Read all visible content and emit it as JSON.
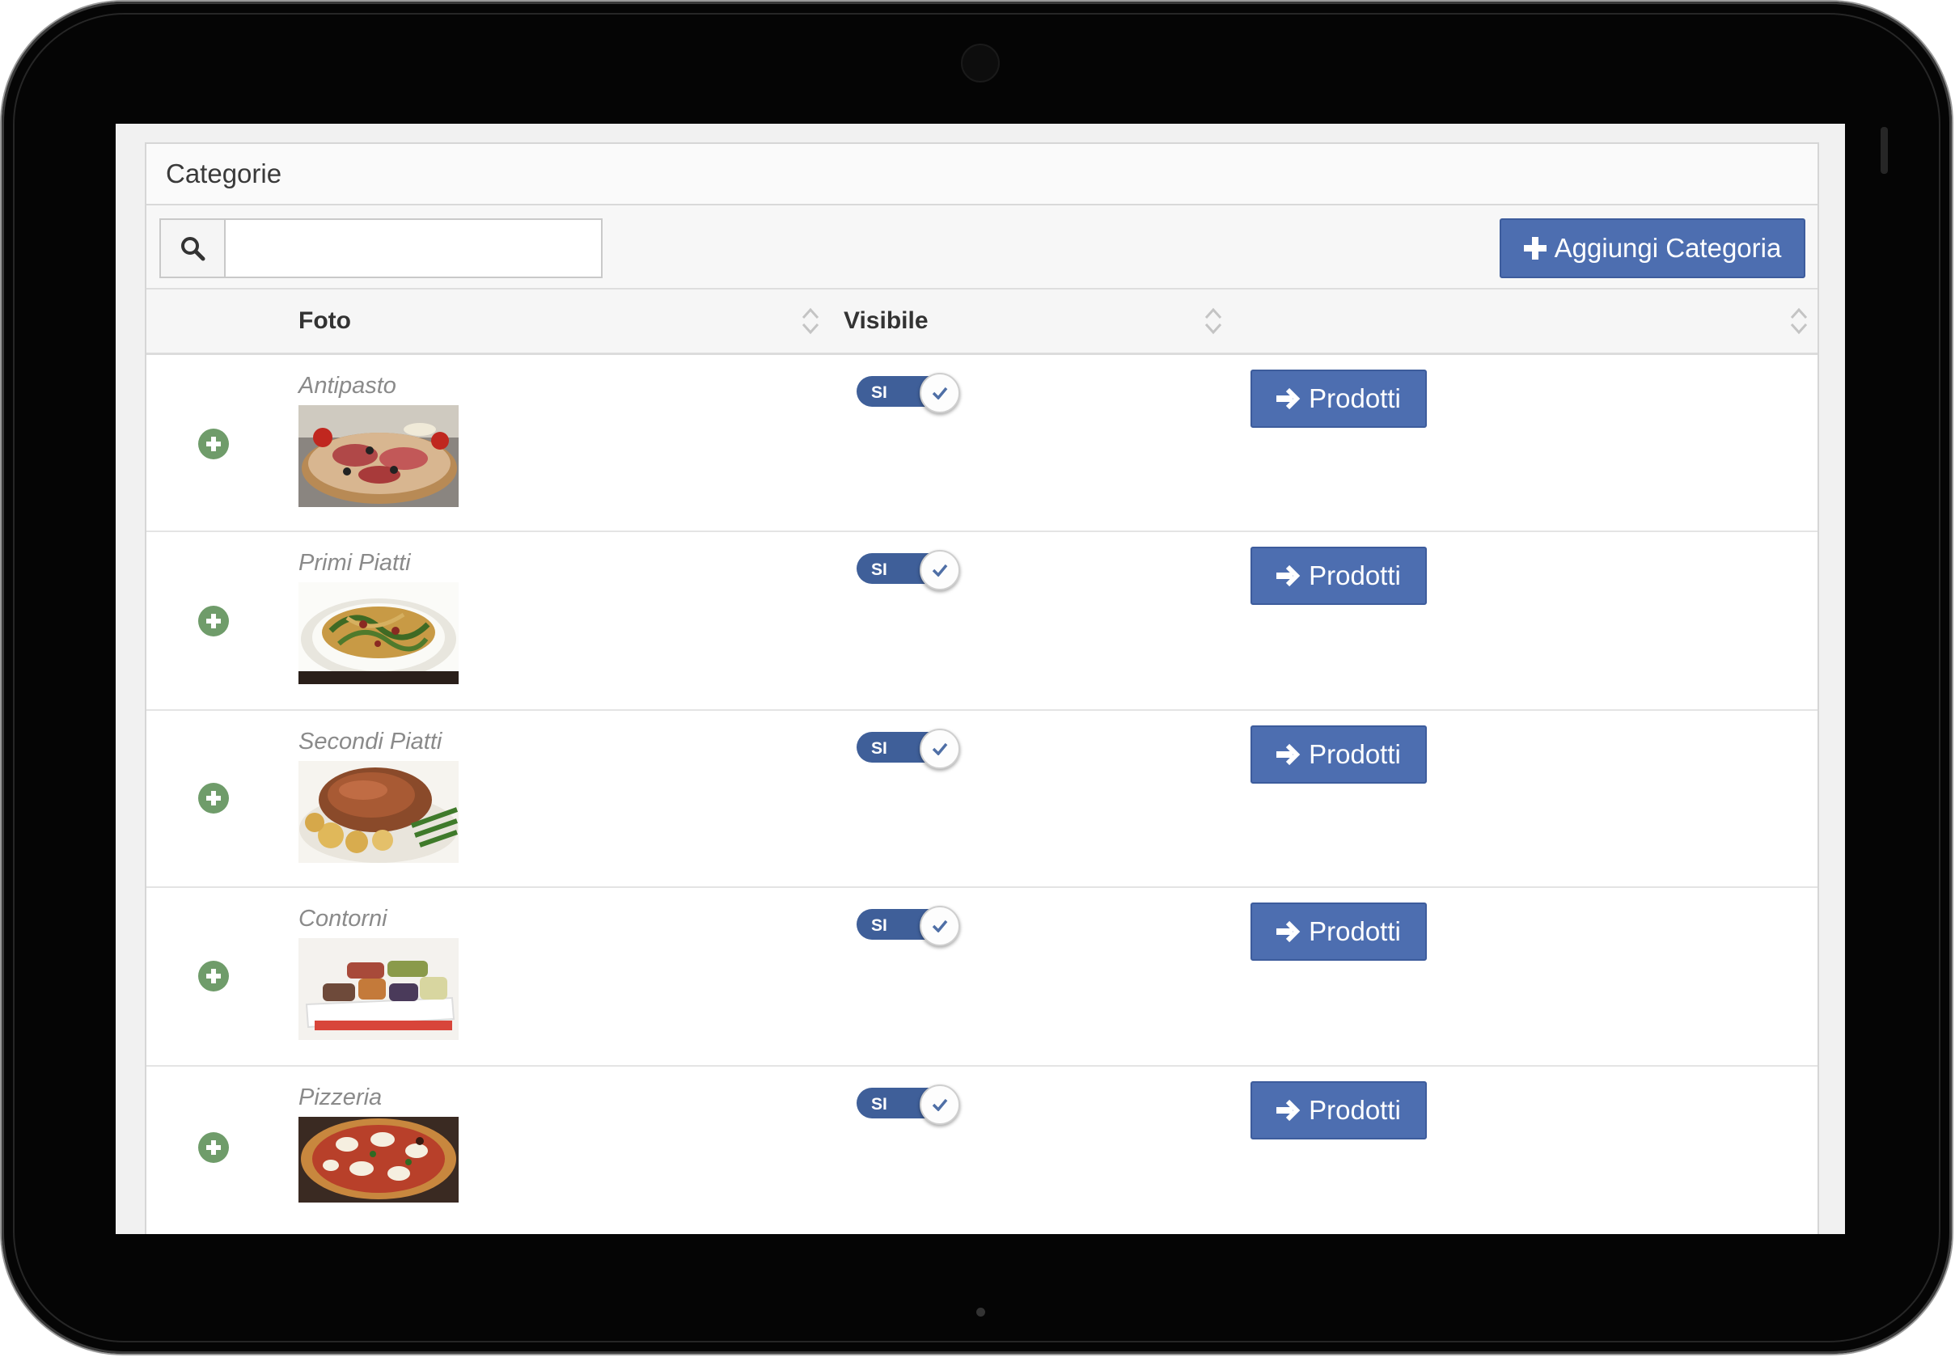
{
  "panel": {
    "title": "Categorie"
  },
  "toolbar": {
    "search_placeholder": "",
    "add_button_label": "Aggiungi Categoria"
  },
  "table": {
    "columns": [
      "Foto",
      "Visibile"
    ],
    "rows": [
      {
        "name": "Antipasto",
        "visible_label": "SI",
        "products_label": "Prodotti"
      },
      {
        "name": "Primi Piatti",
        "visible_label": "SI",
        "products_label": "Prodotti"
      },
      {
        "name": "Secondi Piatti",
        "visible_label": "SI",
        "products_label": "Prodotti"
      },
      {
        "name": "Contorni",
        "visible_label": "SI",
        "products_label": "Prodotti"
      },
      {
        "name": "Pizzeria",
        "visible_label": "SI",
        "products_label": "Prodotti"
      }
    ]
  },
  "colors": {
    "primary_button": "#4d6eb0",
    "toggle_track": "#3f5f99",
    "expand_icon": "#6f9c6a"
  },
  "icons": [
    "search-icon",
    "plus-icon",
    "sort-icon",
    "expand-plus-icon",
    "check-icon",
    "arrow-right-icon"
  ]
}
